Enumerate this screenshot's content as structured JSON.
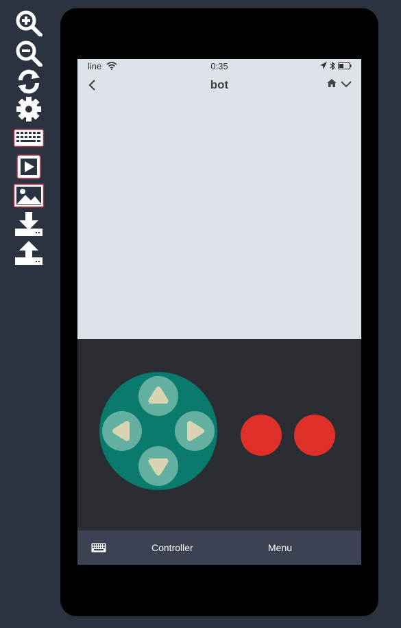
{
  "toolbar": {
    "tools": [
      "zoom-in-icon",
      "zoom-out-icon",
      "refresh-icon",
      "settings-gear-icon",
      "keyboard-icon",
      "play-icon",
      "image-icon",
      "download-icon",
      "upload-icon"
    ]
  },
  "status_bar": {
    "carrier": "line",
    "time": "0:35"
  },
  "nav": {
    "title": "bot"
  },
  "tabbar": {
    "controller_label": "Controller",
    "menu_label": "Menu"
  },
  "colors": {
    "background": "#2b3340",
    "screen": "#dde1e8",
    "controller_bg": "#2a2d31",
    "dpad": "#0a7a6e",
    "dpad_button": "#64b0a0",
    "arrow": "#d8d3b0",
    "action_button": "#e0302a",
    "tabbar": "#3c4254"
  }
}
